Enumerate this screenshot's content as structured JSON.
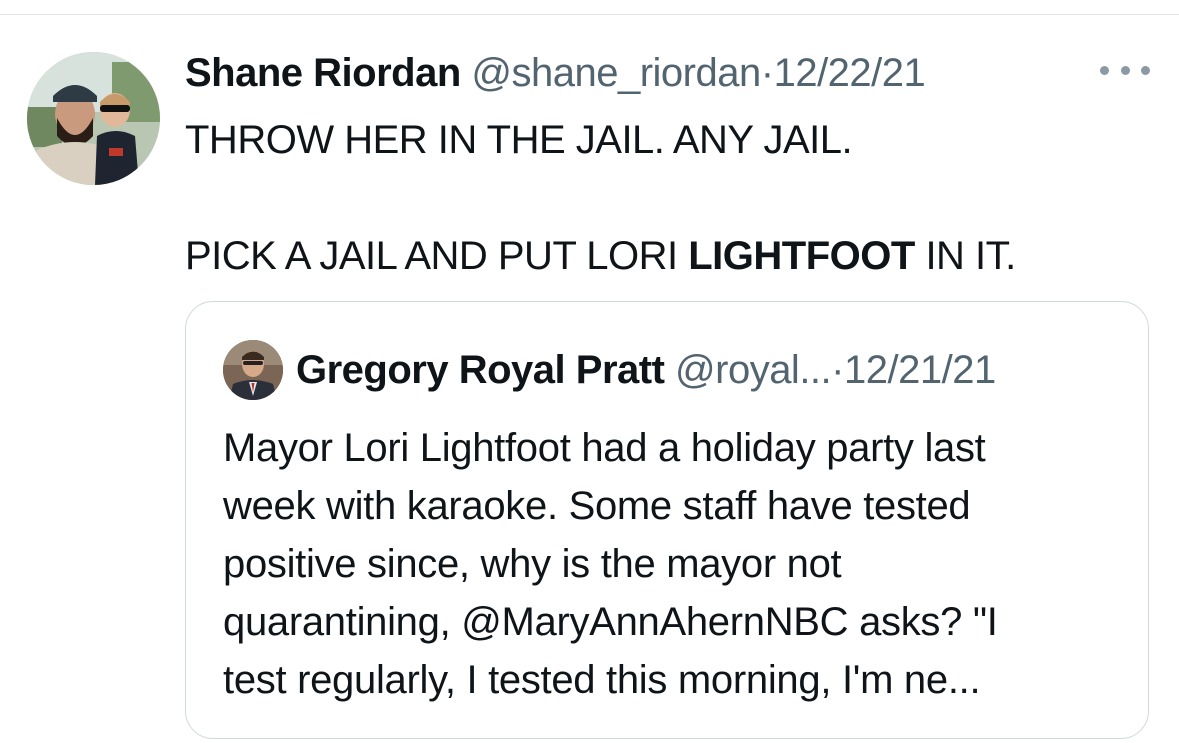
{
  "tweet": {
    "author_name": "Shane Riordan",
    "handle": "@shane_riordan",
    "separator": "·",
    "date": "12/22/21",
    "line1": "THROW HER IN THE JAIL. ANY JAIL.",
    "line2_prefix": "PICK A JAIL AND PUT LORI ",
    "line2_bold": "LIGHTFOOT",
    "line2_suffix": " IN IT.",
    "avatar_icon": "profile-photo-man-with-child",
    "more_icon": "more-horizontal-icon"
  },
  "quoted_tweet": {
    "author_name": "Gregory Royal Pratt",
    "handle": "@royal...",
    "separator": "·",
    "date": "12/21/21",
    "lines": [
      "Mayor Lori Lightfoot had a holiday party last",
      "week with karaoke. Some staff have tested",
      "positive since, why is the mayor not",
      "quarantining, @MaryAnnAhernNBC asks? \"I",
      "test regularly, I tested this morning, I'm ne..."
    ],
    "avatar_icon": "profile-photo-man-in-suit"
  },
  "colors": {
    "text_primary": "#0f1419",
    "text_secondary": "#536471",
    "border": "#cfd9de"
  }
}
